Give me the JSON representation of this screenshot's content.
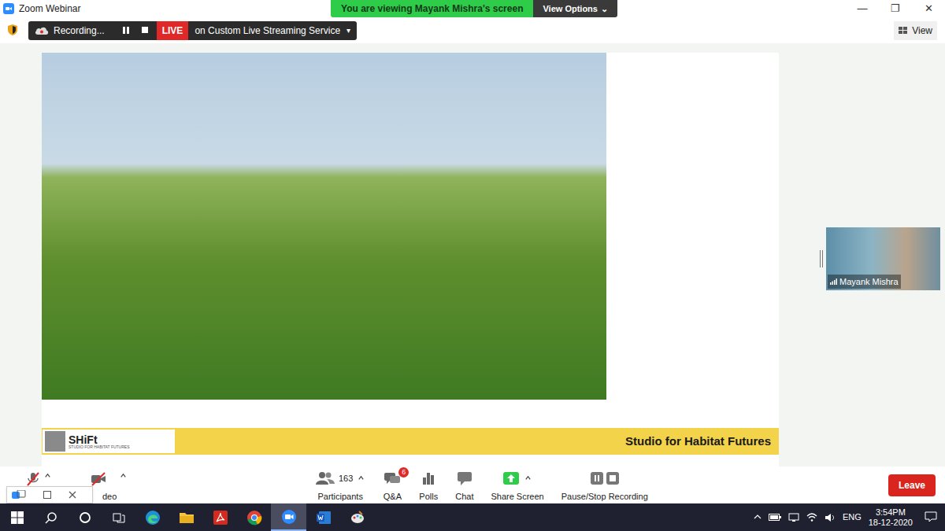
{
  "window": {
    "title": "Zoom Webinar",
    "banner": "You are viewing Mayank Mishra's screen",
    "view_options": "View Options",
    "view_options_caret": "⌄",
    "controls": [
      "—",
      "❐",
      "✕"
    ]
  },
  "recording": {
    "label": "Recording...",
    "live": "LIVE",
    "stream": "on Custom Live Streaming Service",
    "stream_caret": "▾"
  },
  "view": {
    "label": "View"
  },
  "slide": {
    "logo": "SHiFt",
    "logo_sub": "STUDIO FOR HABITAT FUTURES",
    "footer": "Studio for Habitat Futures"
  },
  "speaker": {
    "name": "Mayank Mishra"
  },
  "toolbar": {
    "mic": {
      "muted": true
    },
    "video": {
      "label": "deo",
      "off": true
    },
    "items": [
      {
        "label": "Participants",
        "count": "163",
        "kind": "participants"
      },
      {
        "label": "Q&A",
        "badge": "6",
        "kind": "qa"
      },
      {
        "label": "Polls",
        "kind": "polls"
      },
      {
        "label": "Chat",
        "kind": "chat"
      },
      {
        "label": "Share Screen",
        "kind": "share"
      },
      {
        "label": "Pause/Stop Recording",
        "kind": "record"
      }
    ],
    "leave": "Leave"
  },
  "taskbar": {
    "lang": "ENG",
    "time": "3:54PM",
    "date": "18-12-2020"
  }
}
